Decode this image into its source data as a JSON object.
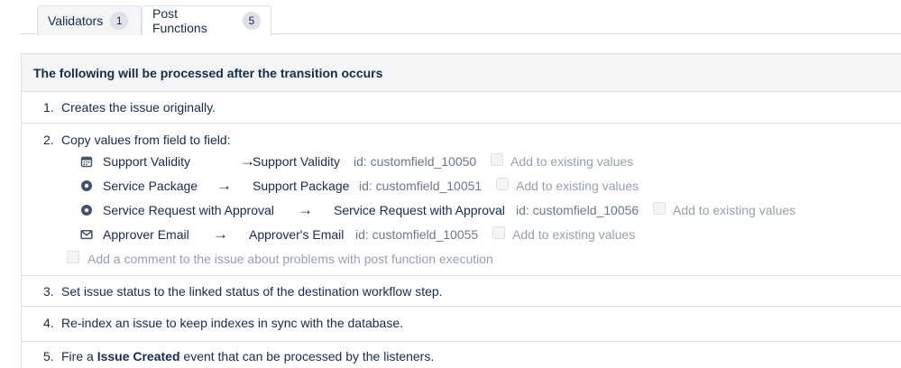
{
  "tabs": [
    {
      "label": "Validators",
      "count": "1"
    },
    {
      "label": "Post Functions",
      "count": "5"
    }
  ],
  "panel": {
    "header": "The following will be processed after the transition occurs"
  },
  "steps": [
    {
      "num": "1.",
      "text": "Creates the issue originally."
    },
    {
      "num": "2.",
      "text": "Copy values from field to field:",
      "mappings": [
        {
          "icon": "calendar-icon",
          "source": "Support Validity",
          "target": "Support Validity",
          "id": "id: customfield_10050",
          "option": "Add to existing values"
        },
        {
          "icon": "radio-icon",
          "source": "Service Package",
          "target": "Support Package",
          "id": "id: customfield_10051",
          "option": "Add to existing values"
        },
        {
          "icon": "radio-icon",
          "source": "Service Request with Approval",
          "target": "Service Request with Approval",
          "id": "id: customfield_10056",
          "option": "Add to existing values"
        },
        {
          "icon": "envelope-icon",
          "source": "Approver Email",
          "target": "Approver's Email",
          "id": "id: customfield_10055",
          "option": "Add to existing values"
        }
      ],
      "comment_option": "Add a comment to the issue about problems with post function execution"
    },
    {
      "num": "3.",
      "text": "Set issue status to the linked status of the destination workflow step."
    },
    {
      "num": "4.",
      "text": "Re-index an issue to keep indexes in sync with the database."
    },
    {
      "num": "5.",
      "text_before": "Fire a ",
      "text_bold": "Issue Created",
      "text_after": " event that can be processed by the listeners."
    }
  ],
  "arrow_glyph": "→"
}
